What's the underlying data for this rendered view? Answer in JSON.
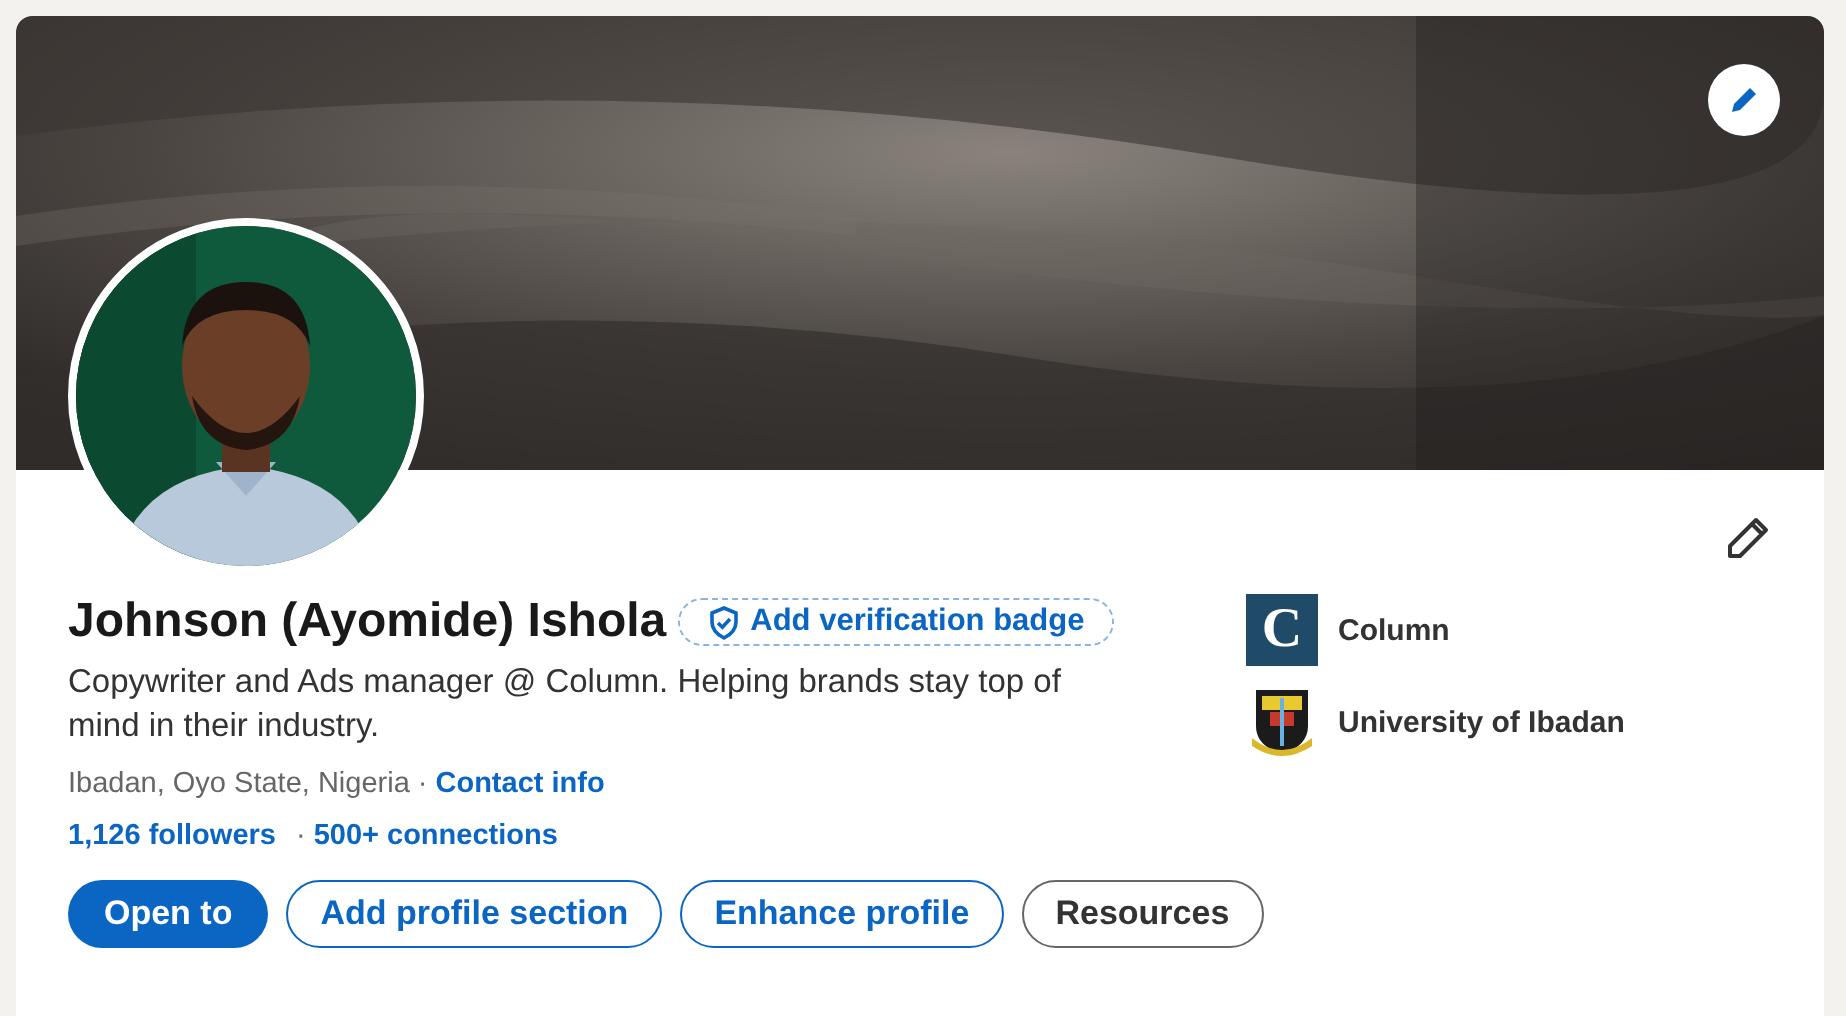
{
  "profile": {
    "name": "Johnson (Ayomide) Ishola",
    "verification": "Add verification badge",
    "headline": "Copywriter and Ads manager @ Column. Helping brands stay top of mind in their industry.",
    "location": "Ibadan, Oyo State, Nigeria",
    "contact": "Contact info",
    "separator": "·",
    "followers": "1,126 followers",
    "separator_2": "·",
    "connections": "500+ connections"
  },
  "organizations": [
    {
      "name": "Column",
      "kind": "letter",
      "logo_text": "C"
    },
    {
      "name": "University of Ibadan",
      "kind": "crest"
    }
  ],
  "buttons": [
    {
      "label": "Open to",
      "kind": "primary"
    },
    {
      "label": "Add profile section",
      "kind": "outline"
    },
    {
      "label": "Enhance profile",
      "kind": "outline"
    },
    {
      "label": "Resources",
      "kind": "secondary"
    }
  ]
}
